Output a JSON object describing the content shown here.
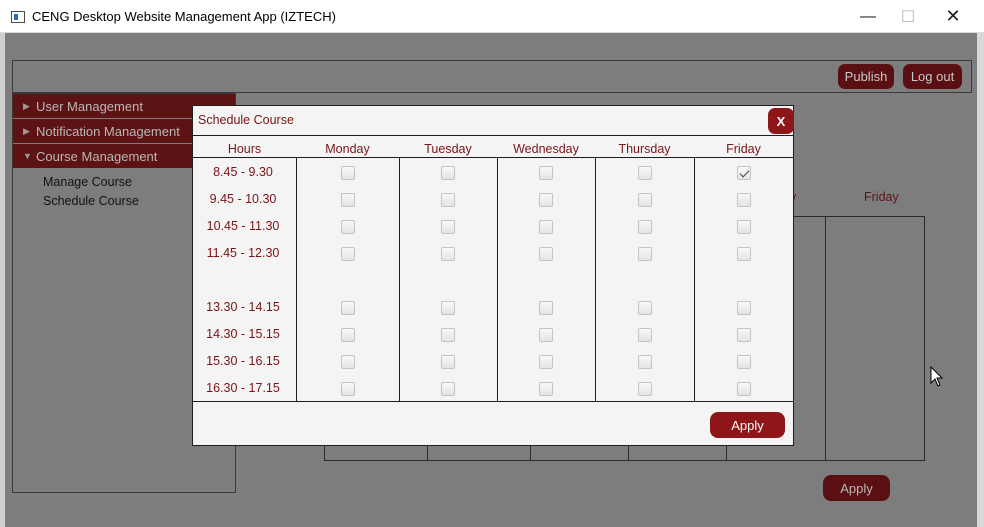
{
  "window": {
    "title": "CENG Desktop Website Management App (IZTECH)",
    "minimize": "—",
    "maximize": "☐",
    "close": "✕"
  },
  "toolbar": {
    "publish_label": "Publish",
    "logout_label": "Log out"
  },
  "sidebar": {
    "items": [
      {
        "label": "User Management",
        "expanded": false
      },
      {
        "label": "Notification Management",
        "expanded": false
      },
      {
        "label": "Course Management",
        "expanded": true
      }
    ],
    "sub_items": [
      "Manage Course",
      "Schedule Course"
    ]
  },
  "background": {
    "friday_label": "Friday",
    "thursday_tail": "y",
    "apply_label": "Apply"
  },
  "dialog": {
    "title": "Schedule Course",
    "close_label": "X",
    "columns": [
      "Hours",
      "Monday",
      "Tuesday",
      "Wednesday",
      "Thursday",
      "Friday"
    ],
    "hours": [
      "8.45 - 9.30",
      "9.45 - 10.30",
      "10.45 - 11.30",
      "11.45 - 12.30",
      "",
      "13.30 - 14.15",
      "14.30 - 15.15",
      "15.30 - 16.15",
      "16.30 - 17.15"
    ],
    "checked": [
      [
        0,
        4
      ]
    ],
    "apply_label": "Apply"
  },
  "colors": {
    "accent": "#8e1518",
    "accent_text": "#7a1418",
    "overlay": "#7d7d7d"
  }
}
